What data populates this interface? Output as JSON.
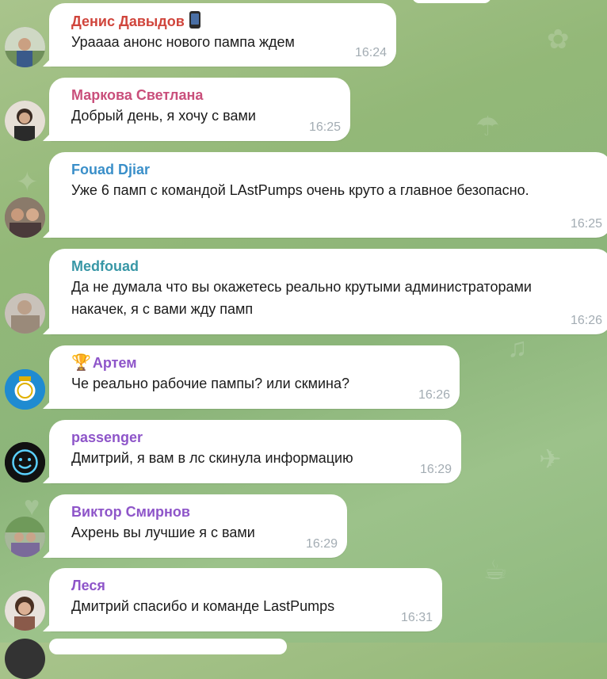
{
  "chat": {
    "messages": [
      {
        "sender": "Денис Давыдов",
        "sender_color": "#d0453c",
        "badge": "phone",
        "text": "Ураааа анонс нового пампа ждем",
        "time": "16:24"
      },
      {
        "sender": "Маркова Светлана",
        "sender_color": "#c94f7b",
        "text": "Добрый день, я хочу с вами",
        "time": "16:25"
      },
      {
        "sender": "Fouad Djiar",
        "sender_color": "#3a8fc9",
        "text": "Уже 6 памп с командой LAstPumps очень круто а главное безопасно.",
        "time": "16:25"
      },
      {
        "sender": "Medfouad",
        "sender_color": "#3897a6",
        "text": "Да не думала что вы окажетесь реально крутыми администраторами накачек, я с вами жду памп",
        "time": "16:26"
      },
      {
        "sender": "Артем",
        "sender_color": "#8e55c9",
        "badge": "trophy",
        "text": "Че реально рабочие пампы? или скмина?",
        "time": "16:26"
      },
      {
        "sender": "passenger",
        "sender_color": "#8e55c9",
        "text": "Дмитрий, я вам в лс скинула информацию",
        "time": "16:29"
      },
      {
        "sender": "Виктор Смирнов",
        "sender_color": "#8e55c9",
        "text": "Ахрень вы лучшие я с вами",
        "time": "16:29"
      },
      {
        "sender": "Леся",
        "sender_color": "#8e55c9",
        "text": "Дмитрий спасибо и команде LastPumps",
        "time": "16:31"
      }
    ]
  }
}
